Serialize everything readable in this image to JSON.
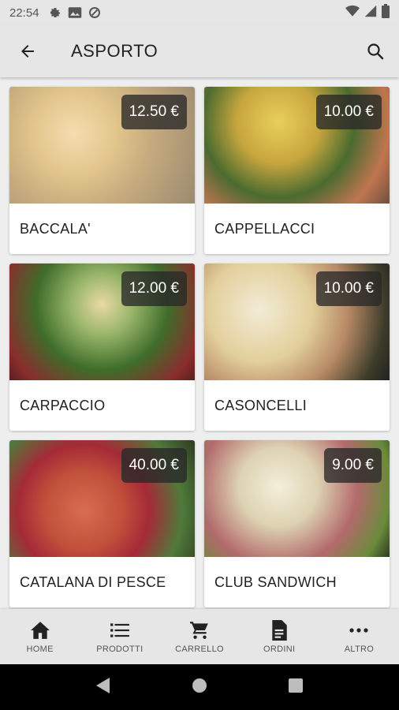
{
  "status_bar": {
    "time": "22:54"
  },
  "app_bar": {
    "title": "ASPORTO"
  },
  "products": [
    {
      "name": "BACCALA'",
      "price": "12.50 €"
    },
    {
      "name": "CAPPELLACCI",
      "price": "10.00 €"
    },
    {
      "name": "CARPACCIO",
      "price": "12.00 €"
    },
    {
      "name": "CASONCELLI",
      "price": "10.00 €"
    },
    {
      "name": "CATALANA DI PESCE",
      "price": "40.00 €"
    },
    {
      "name": "CLUB SANDWICH",
      "price": "9.00 €"
    }
  ],
  "bottom_nav": [
    {
      "label": "HOME",
      "icon": "home-icon"
    },
    {
      "label": "PRODOTTI",
      "icon": "list-icon"
    },
    {
      "label": "CARRELLO",
      "icon": "cart-icon"
    },
    {
      "label": "ORDINI",
      "icon": "document-icon"
    },
    {
      "label": "ALTRO",
      "icon": "more-icon"
    }
  ]
}
